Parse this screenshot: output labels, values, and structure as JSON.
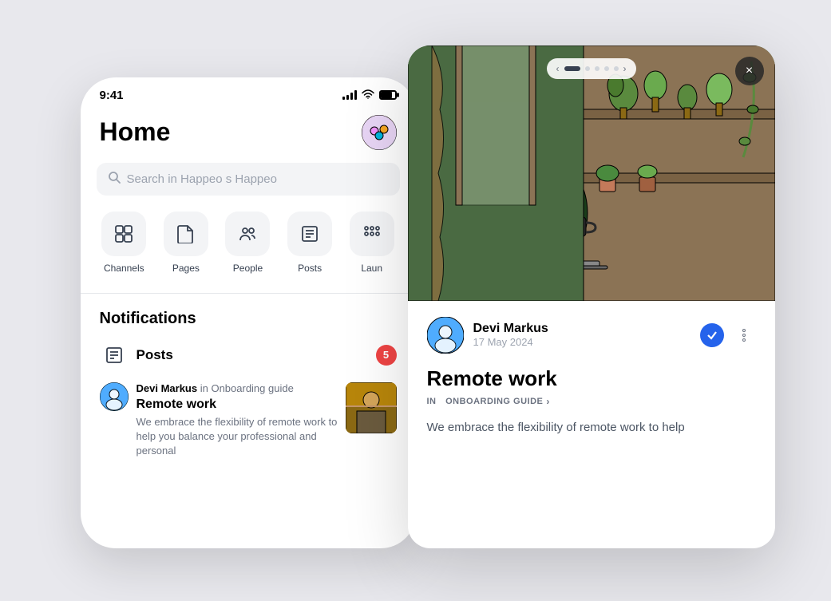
{
  "phone": {
    "status": {
      "time": "9:41"
    },
    "header": {
      "title": "Home",
      "avatar_emoji": "🎨"
    },
    "search": {
      "placeholder": "Search in Happeo s Happeo"
    },
    "nav": {
      "items": [
        {
          "id": "channels",
          "label": "Channels",
          "icon": "layers"
        },
        {
          "id": "pages",
          "label": "Pages",
          "icon": "book"
        },
        {
          "id": "people",
          "label": "People",
          "icon": "people"
        },
        {
          "id": "posts",
          "label": "Posts",
          "icon": "doc"
        },
        {
          "id": "launch",
          "label": "Laun",
          "icon": "grid"
        }
      ]
    },
    "notifications": {
      "title": "Notifications",
      "posts_label": "Posts",
      "badge": "5",
      "post": {
        "author": "Devi Markus",
        "channel": "Onboarding guide",
        "title": "Remote work",
        "excerpt": "We embrace the flexibility of remote work to help you balance your professional and personal"
      }
    }
  },
  "card": {
    "carousel": {
      "dots": [
        true,
        false,
        false,
        false,
        false
      ]
    },
    "close_label": "×",
    "author": {
      "name": "Devi Markus",
      "date": "17 May 2024"
    },
    "post_title": "Remote work",
    "channel": {
      "label": "ONBOARDING GUIDE",
      "arrow": "›"
    },
    "excerpt": "We embrace the flexibility of remote work to help"
  }
}
